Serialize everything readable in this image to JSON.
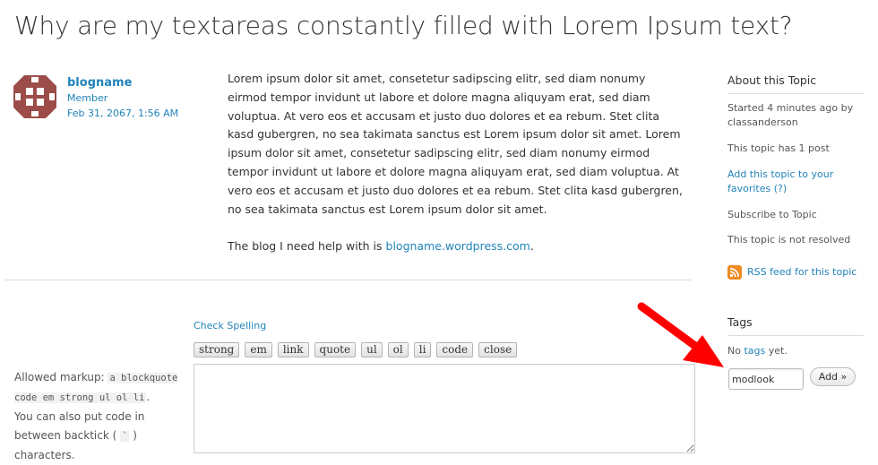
{
  "page": {
    "title": "Why are my textareas constantly filled with Lorem Ipsum text?"
  },
  "post": {
    "author": {
      "name": "blogname",
      "role": "Member",
      "date": "Feb 31, 2067, 1:56 AM"
    },
    "body": "Lorem ipsum dolor sit amet, consetetur sadipscing elitr, sed diam nonumy eirmod tempor invidunt ut labore et dolore magna aliquyam erat, sed diam voluptua. At vero eos et accusam et justo duo dolores et ea rebum. Stet clita kasd gubergren, no sea takimata sanctus est Lorem ipsum dolor sit amet. Lorem ipsum dolor sit amet, consetetur sadipscing elitr, sed diam nonumy eirmod tempor invidunt ut labore et dolore magna aliquyam erat, sed diam voluptua. At vero eos et accusam et justo duo dolores et ea rebum. Stet clita kasd gubergren, no sea takimata sanctus est Lorem ipsum dolor sit amet.",
    "blog_line_prefix": "The blog I need help with is ",
    "blog_link": "blogname.wordpress.com",
    "blog_line_suffix": "."
  },
  "reply": {
    "check_spelling": "Check Spelling",
    "toolbar": [
      "strong",
      "em",
      "link",
      "quote",
      "ul",
      "ol",
      "li",
      "code",
      "close"
    ],
    "allowed_markup_label": "Allowed markup: ",
    "allowed_markup_tags": "a blockquote code em strong ul ol li",
    "allowed_markup_suffix": ".",
    "backtick_prefix": "You can also put code in between backtick ( ",
    "backtick_char": "`",
    "backtick_suffix": " ) characters."
  },
  "sidebar": {
    "about_heading": "About this Topic",
    "started": "Started 4 minutes ago by classanderson",
    "post_count": "This topic has 1 post",
    "add_favorites": "Add this topic to your favorites",
    "favorites_help": "(?)",
    "subscribe": "Subscribe to Topic",
    "resolved_status": "This topic is not resolved",
    "rss_link": "RSS feed for this topic",
    "tags_heading": "Tags",
    "no_tags_prefix": "No ",
    "no_tags_link": "tags",
    "no_tags_suffix": " yet.",
    "tag_input_value": "modlook",
    "add_button": "Add »"
  },
  "colors": {
    "link": "#2183b9",
    "annotation_arrow": "#ff0000",
    "rss": "#f08a24",
    "avatar": "#9c4d4a"
  }
}
